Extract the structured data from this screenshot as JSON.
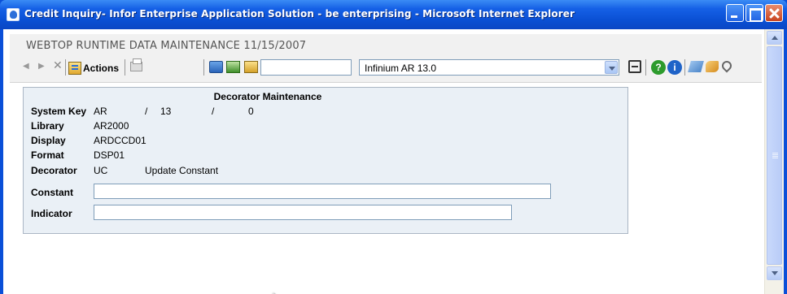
{
  "window": {
    "title": "Credit Inquiry- Infor Enterprise Application Solution - be enterprising - Microsoft Internet Explorer"
  },
  "app": {
    "title": "WEBTOP RUNTIME DATA MAINTENANCE 11/15/2007"
  },
  "toolbar": {
    "actions_label": "Actions",
    "search_value": "",
    "environment_select_value": "Infinium AR 13.0",
    "help_glyph": "?",
    "info_glyph": "i"
  },
  "form": {
    "title": "Decorator Maintenance",
    "system_key_label": "System Key",
    "system_key_part1": "AR",
    "system_key_sep1": "/",
    "system_key_part2": "13",
    "system_key_sep2": "/",
    "system_key_part3": "0",
    "library_label": "Library",
    "library_value": "AR2000",
    "display_label": "Display",
    "display_value": "ARDCCD01",
    "format_label": "Format",
    "format_value": "DSP01",
    "decorator_label": "Decorator",
    "decorator_code": "UC",
    "decorator_desc": "Update Constant",
    "constant_label": "Constant",
    "constant_value": "",
    "indicator_label": "Indicator",
    "indicator_value": ""
  },
  "icons": {
    "back": "back-icon",
    "forward": "forward-icon",
    "stop": "close-icon",
    "help": "help-icon",
    "info": "info-icon"
  },
  "colors": {
    "titlebar": "#0a4fd3",
    "panel_bg": "#eaf0f6",
    "help": "#2d9b2d",
    "info": "#1f63c8"
  }
}
